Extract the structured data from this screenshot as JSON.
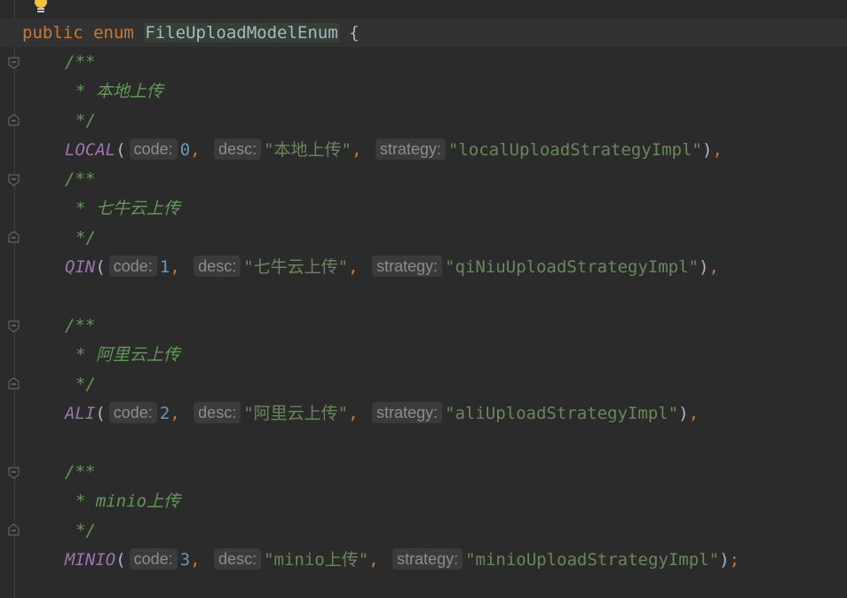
{
  "header": {
    "kw_public": "public",
    "kw_enum": "enum",
    "class_name": "FileUploadModelEnum",
    "brace": "{"
  },
  "hints": {
    "code": "code:",
    "desc": "desc:",
    "strategy": "strategy:"
  },
  "comment": {
    "open": "/**",
    "close": "*/",
    "star": "* "
  },
  "entries": [
    {
      "comment": "本地上传",
      "name": "LOCAL",
      "code": "0",
      "desc": "\"本地上传\"",
      "strategy": "\"localUploadStrategyImpl\"",
      "end": "),"
    },
    {
      "comment": "七牛云上传",
      "name": "QIN",
      "code": "1",
      "desc": "\"七牛云上传\"",
      "strategy": "\"qiNiuUploadStrategyImpl\"",
      "end": "),"
    },
    {
      "comment": "阿里云上传",
      "name": "ALI",
      "code": "2",
      "desc": "\"阿里云上传\"",
      "strategy": "\"aliUploadStrategyImpl\"",
      "end": "),"
    },
    {
      "comment": "minio上传",
      "name": "MINIO",
      "code": "3",
      "desc": "\"minio上传\"",
      "strategy": "\"minioUploadStrategyImpl\"",
      "end": ");"
    }
  ],
  "colors": {
    "background": "#2b2b2b",
    "keyword": "#cc7832",
    "comment": "#629755",
    "constant": "#9876aa",
    "number": "#6897bb",
    "string": "#6a8759",
    "text": "#a9b7c6",
    "bulb": "#f0c338"
  },
  "icons": [
    "lightbulb-icon",
    "fold-marker-icon"
  ]
}
